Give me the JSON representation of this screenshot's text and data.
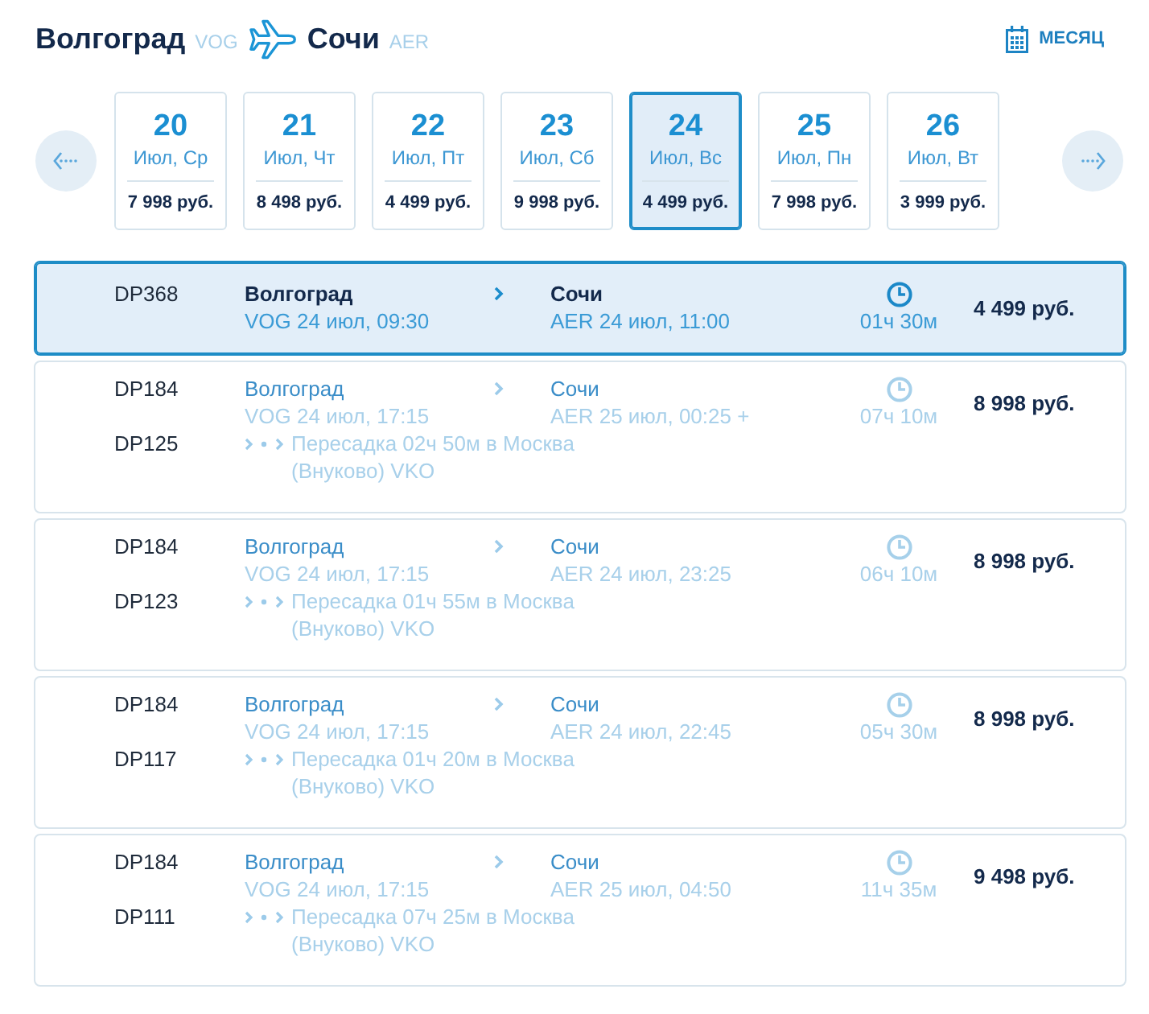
{
  "header": {
    "origin": {
      "city": "Волгоград",
      "code": "VOG"
    },
    "destination": {
      "city": "Сочи",
      "code": "AER"
    },
    "month_button": "МЕСЯЦ"
  },
  "date_strip": {
    "days": [
      {
        "day": "20",
        "label": "Июл, Ср",
        "price": "7 998 руб.",
        "selected": false
      },
      {
        "day": "21",
        "label": "Июл, Чт",
        "price": "8 498 руб.",
        "selected": false
      },
      {
        "day": "22",
        "label": "Июл, Пт",
        "price": "4 499 руб.",
        "selected": false
      },
      {
        "day": "23",
        "label": "Июл, Сб",
        "price": "9 998 руб.",
        "selected": false
      },
      {
        "day": "24",
        "label": "Июл, Вс",
        "price": "4 499 руб.",
        "selected": true
      },
      {
        "day": "25",
        "label": "Июл, Пн",
        "price": "7 998 руб.",
        "selected": false
      },
      {
        "day": "26",
        "label": "Июл, Вт",
        "price": "3 999 руб.",
        "selected": false
      }
    ]
  },
  "flights": [
    {
      "selected": true,
      "numbers": [
        "DP368"
      ],
      "from": {
        "city": "Волгоград",
        "time": "VOG 24 июл, 09:30"
      },
      "to": {
        "city": "Сочи",
        "time": "AER 24 июл, 11:00"
      },
      "duration": "01ч 30м",
      "price": "4 499 руб."
    },
    {
      "selected": false,
      "numbers": [
        "DP184",
        "DP125"
      ],
      "from": {
        "city": "Волгоград",
        "time": "VOG 24 июл, 17:15"
      },
      "to": {
        "city": "Сочи",
        "time": "AER 25 июл, 00:25 +"
      },
      "duration": "07ч 10м",
      "price": "8 998 руб.",
      "transfer": "Пересадка 02ч 50м в Москва (Внуково) VKO"
    },
    {
      "selected": false,
      "numbers": [
        "DP184",
        "DP123"
      ],
      "from": {
        "city": "Волгоград",
        "time": "VOG 24 июл, 17:15"
      },
      "to": {
        "city": "Сочи",
        "time": "AER 24 июл, 23:25"
      },
      "duration": "06ч 10м",
      "price": "8 998 руб.",
      "transfer": "Пересадка 01ч 55м в Москва (Внуково) VKO"
    },
    {
      "selected": false,
      "numbers": [
        "DP184",
        "DP117"
      ],
      "from": {
        "city": "Волгоград",
        "time": "VOG 24 июл, 17:15"
      },
      "to": {
        "city": "Сочи",
        "time": "AER 24 июл, 22:45"
      },
      "duration": "05ч 30м",
      "price": "8 998 руб.",
      "transfer": "Пересадка 01ч 20м в Москва (Внуково) VKO"
    },
    {
      "selected": false,
      "numbers": [
        "DP184",
        "DP111"
      ],
      "from": {
        "city": "Волгоград",
        "time": "VOG 24 июл, 17:15"
      },
      "to": {
        "city": "Сочи",
        "time": "AER 25 июл, 04:50"
      },
      "duration": "11ч 35м",
      "price": "9 498 руб.",
      "transfer": "Пересадка 07ч 25м в Москва (Внуково) VKO"
    }
  ]
}
